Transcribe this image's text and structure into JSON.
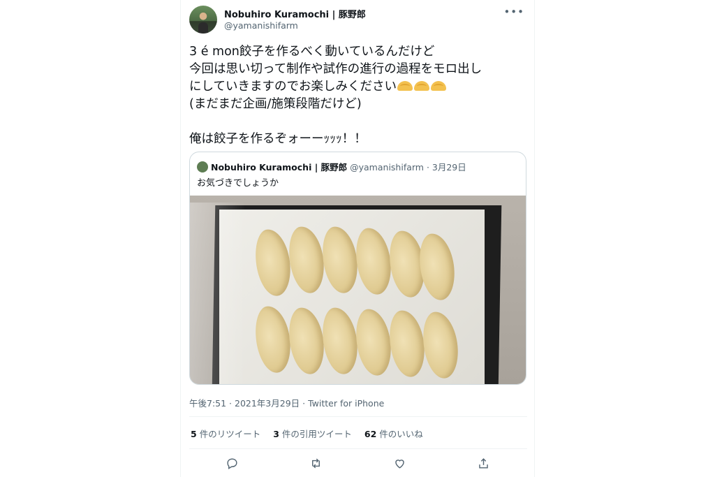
{
  "author": {
    "name": "Nobuhiro Kuramochi | 豚野郎",
    "handle": "@yamanishifarm",
    "more_icon": "more-dots-icon"
  },
  "tweet": {
    "line1": "3 é mon餃子を作るべく動いているんだけど",
    "line2": "今回は思い切って制作や試作の進行の過程をモロ出し",
    "line3": "にしていきますのでお楽しみください",
    "line3_emoji": "dumpling-emoji",
    "line4": "(まだまだ企画/施策段階だけど)",
    "line5": "俺は餃子を作るぞォーーｯｯｯ！！"
  },
  "quote": {
    "name": "Nobuhiro Kuramochi | 豚野郎",
    "handle_date": "@yamanishifarm · 3月29日",
    "text": "お気づきでしょうか",
    "photo_subject": "frozen gyoza dumplings in a tray"
  },
  "timestamp": "午後7:51 · 2021年3月29日 · Twitter for iPhone",
  "stats": {
    "retweets_count": "5",
    "retweets_label": "件のリツイート",
    "quotes_count": "3",
    "quotes_label": "件の引用ツイート",
    "likes_count": "62",
    "likes_label": "件のいいね"
  },
  "actions": [
    "reply-icon",
    "retweet-icon",
    "like-icon",
    "share-icon"
  ]
}
